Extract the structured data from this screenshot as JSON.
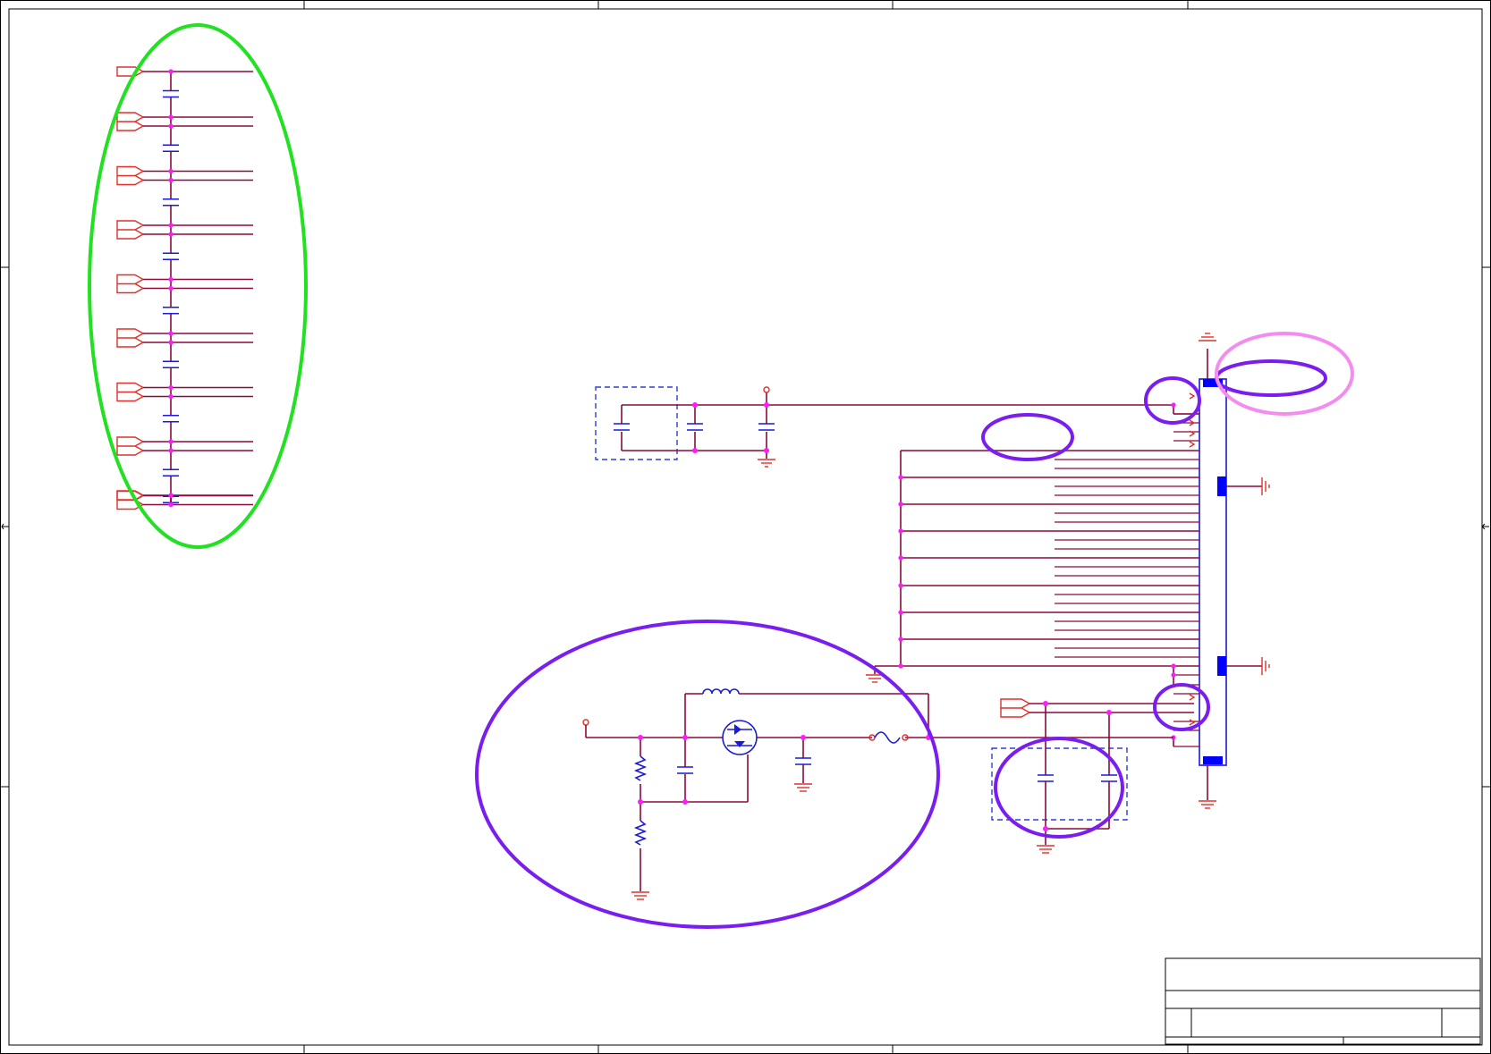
{
  "title_block": {
    "title": "",
    "company": "",
    "size": "",
    "document_number": "",
    "revision": "",
    "date": "",
    "sheet": ""
  },
  "colors": {
    "wire": "#8b0a3c",
    "component": "#1a1ad8",
    "port": "#e0302a",
    "junction": "#ff1aff",
    "highlight_green": "#22e022",
    "highlight_purple": "#7a1ef0",
    "highlight_pink": "#f48cf0"
  }
}
